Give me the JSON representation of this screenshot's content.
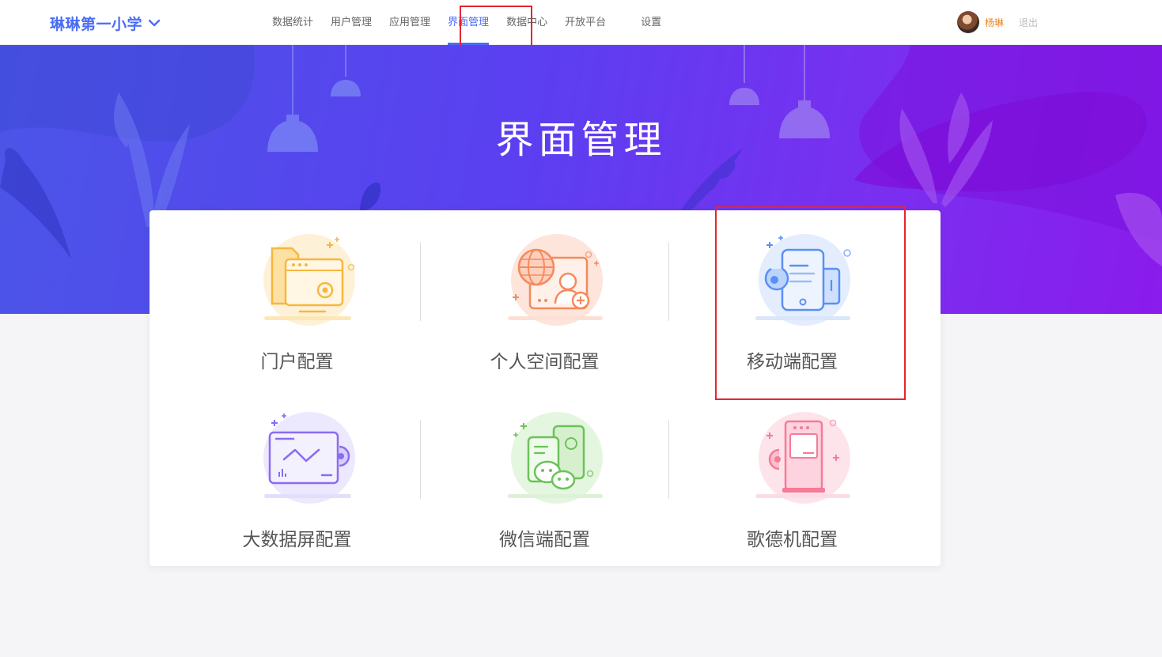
{
  "header": {
    "school_name": "琳琳第一小学",
    "nav": [
      {
        "label": "数据统计"
      },
      {
        "label": "用户管理"
      },
      {
        "label": "应用管理"
      },
      {
        "label": "界面管理",
        "active": true
      },
      {
        "label": "数据中心"
      },
      {
        "label": "开放平台"
      },
      {
        "label": "设置"
      }
    ],
    "user_name": "杨琳",
    "logout_label": "退出"
  },
  "banner": {
    "title": "界面管理"
  },
  "tiles": [
    {
      "label": "门户配置",
      "icon": "portal-config-icon",
      "color": "#f7b73f"
    },
    {
      "label": "个人空间配置",
      "icon": "personal-space-config-icon",
      "color": "#f58a5c"
    },
    {
      "label": "移动端配置",
      "icon": "mobile-config-icon",
      "color": "#5a8ff5"
    },
    {
      "label": "大数据屏配置",
      "icon": "big-data-screen-config-icon",
      "color": "#8a6cf2"
    },
    {
      "label": "微信端配置",
      "icon": "wechat-config-icon",
      "color": "#6cc25a"
    },
    {
      "label": "歌德机配置",
      "icon": "kiosk-config-icon",
      "color": "#f77a98"
    }
  ],
  "colors": {
    "accent": "#4a6cf7",
    "highlight": "#e3262f",
    "user_name": "#e3831f"
  }
}
